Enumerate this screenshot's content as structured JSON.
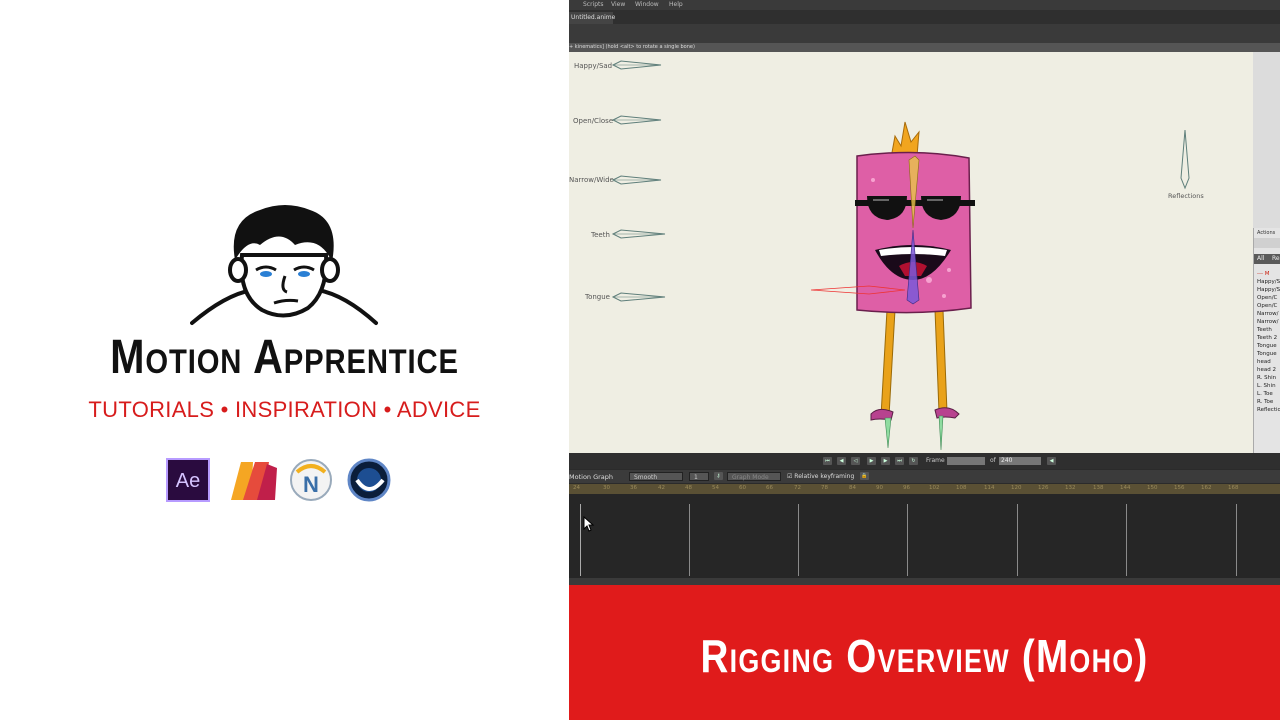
{
  "brand": {
    "title": "Motion Apprentice",
    "tagline": "TUTORIALS • INSPIRATION • ADVICE",
    "logos": [
      {
        "name": "after-effects-logo",
        "text": "Ae"
      },
      {
        "name": "moho-logo"
      },
      {
        "name": "modo-logo"
      },
      {
        "name": "cinema4d-logo"
      }
    ]
  },
  "app": {
    "menu": [
      "Scripts",
      "View",
      "Window",
      "Help"
    ],
    "document_tab": "Untitled.anime",
    "hint": "+ kinematics] (hold <alt> to rotate a single bone)",
    "switch_labels": [
      "Happy/Sad",
      "Open/Close",
      "Narrow/Wide",
      "Teeth",
      "Tongue"
    ],
    "reflections_label": "Reflections",
    "actions": {
      "title": "Actions",
      "tabs": [
        "All",
        "Re"
      ],
      "items": [
        "--- M",
        "Happy/S",
        "Happy/S",
        "Open/C",
        "Open/C",
        "Narrow/",
        "Narrow/",
        "Teeth",
        "Teeth 2",
        "Tongue",
        "Tongue",
        "head",
        "head 2",
        "R. Shin",
        "L. Shin",
        "L. Toe",
        "R. Toe",
        "Reflectio"
      ]
    },
    "transport": {
      "frame_label": "Frame",
      "frame_value": "",
      "of_label": "of",
      "total_frames": "240"
    },
    "timeline": {
      "title": "Motion Graph",
      "interp": "Smooth",
      "interp_count": "1",
      "channel": "Graph Mode",
      "relative_keyframing": "Relative keyframing",
      "ticks": [
        "24",
        "30",
        "36",
        "42",
        "48",
        "54",
        "60",
        "66",
        "72",
        "78",
        "84",
        "90",
        "96",
        "102",
        "108",
        "114",
        "120",
        "126",
        "132",
        "138",
        "144",
        "150",
        "156",
        "162",
        "168"
      ]
    }
  },
  "banner": {
    "title": "Rigging Overview (Moho)"
  },
  "colors": {
    "accent_red": "#e01b1b",
    "tagline_red": "#d71c1c",
    "canvas_bg": "#efeee3",
    "character_pink": "#de5fa6",
    "character_legs": "#e9a21a"
  }
}
